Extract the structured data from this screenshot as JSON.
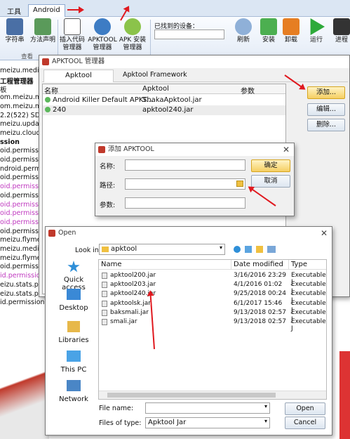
{
  "ribbon": {
    "tabs": [
      "工具",
      "Android"
    ],
    "buttons": [
      "字符串",
      "方法声明",
      "插入代码管理器",
      "APKTOOL管理器",
      "APK 安装管理器",
      "刷新",
      "安装",
      "卸载",
      "运行",
      "进程"
    ],
    "group_label": "查看",
    "device_label": "已找到的设备："
  },
  "left_list": [
    "meizu.media.",
    "工程管理器",
    "板",
    "om.meizu.mec",
    "om.meizu.mec",
    "2.2(522) SDK",
    "meizu.update.s",
    "meizu.cloud.pu",
    "ssion",
    "oid.permission",
    "oid.permission",
    "ndroid.permi",
    "oid.permission",
    "oid.permission",
    "oid.permission",
    "oid.permission",
    "oid.permission",
    "oid.permission",
    "oid.permission",
    "meizu.flyme.pe",
    "meizu.media.p",
    "meizu.flyme.pu",
    "oid.permission",
    "id.permission.AC",
    "eizu.stats.permi",
    "eizu.stats.permi",
    "id.permission.RC"
  ],
  "apktool_manager": {
    "title": "APKTOOL 管理器",
    "tabs": [
      "Apktool",
      "Apktool Framework"
    ],
    "columns": [
      "名称",
      "Apktool",
      "参数"
    ],
    "rows": [
      {
        "name": "Android Killer Default APKT...",
        "apktool": "ShakaApktool.jar"
      },
      {
        "name": "240",
        "apktool": "apktool240.jar"
      }
    ],
    "buttons": [
      "添加...",
      "编辑...",
      "删除..."
    ]
  },
  "add_dialog": {
    "title": "添加 APKTOOL",
    "labels": [
      "名称:",
      "路径:",
      "参数:"
    ],
    "buttons": [
      "确定",
      "取消"
    ]
  },
  "open_dialog": {
    "title": "Open",
    "look_in_label": "Look in:",
    "look_in_value": "apktool",
    "places": [
      "Quick access",
      "Desktop",
      "Libraries",
      "This PC",
      "Network"
    ],
    "columns": [
      "Name",
      "Date modified",
      "Type"
    ],
    "files": [
      {
        "name": "apktool200.jar",
        "date": "3/16/2016 23:29",
        "type": "Executable J"
      },
      {
        "name": "apktool203.jar",
        "date": "4/1/2016 01:02",
        "type": "Executable J"
      },
      {
        "name": "apktool240.jar",
        "date": "9/25/2018 00:24",
        "type": "Executable J"
      },
      {
        "name": "apktoolsk.jar",
        "date": "6/1/2017 15:46",
        "type": "Executable J"
      },
      {
        "name": "baksmali.jar",
        "date": "9/13/2018 02:57",
        "type": "Executable J"
      },
      {
        "name": "smali.jar",
        "date": "9/13/2018 02:57",
        "type": "Executable J"
      }
    ],
    "file_name_label": "File name:",
    "file_name_value": "",
    "files_of_type_label": "Files of type:",
    "files_of_type_value": "Apktool Jar",
    "buttons": [
      "Open",
      "Cancel"
    ]
  },
  "colors": {
    "accent": "#3a6fb0",
    "arrow": "#e0191f",
    "permission_purple": "#c03ac0"
  }
}
